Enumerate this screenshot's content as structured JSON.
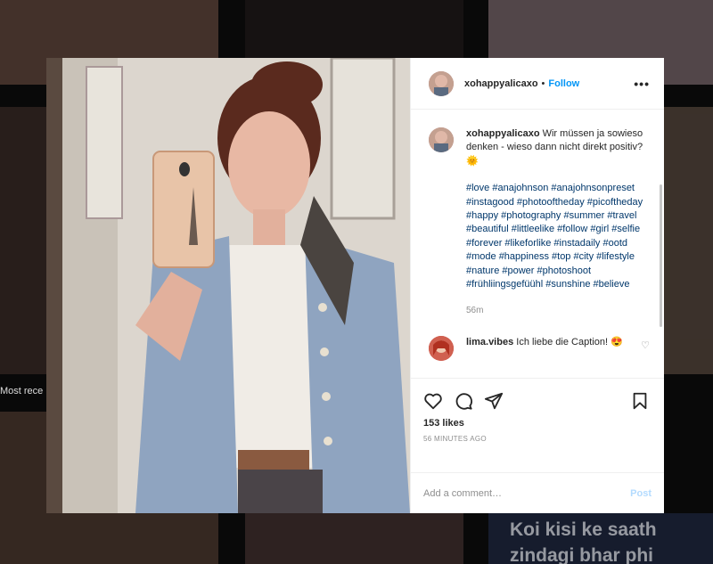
{
  "background": {
    "section_label": "Most rece",
    "text_line1": "Koi kisi ke saath",
    "text_line2": "zindagi bhar phi"
  },
  "post": {
    "username": "xohappyalicaxo",
    "separator": "•",
    "follow_label": "Follow",
    "more_label": "•••",
    "caption": {
      "username": "xohappyalicaxo",
      "text": "Wir müssen ja sowieso denken - wieso dann nicht direkt positiv? 🌞",
      "hashtags": "#love #anajohnson #anajohnsonpreset #instagood #photooftheday #picoftheday #happy #photography #summer #travel #beautiful #littleelike #follow #girl #selfie #forever #likeforlike #instadaily #ootd #mode #happiness #top #city #lifestyle #nature #power #photoshoot #frühliingsgefüühl #sunshine #believe",
      "time": "56m"
    },
    "comments": [
      {
        "username": "lima.vibes",
        "text": "Ich liebe die Caption! 😍"
      }
    ],
    "likes": "153 likes",
    "posted": "56 MINUTES AGO",
    "add_comment_placeholder": "Add a comment…",
    "post_label": "Post"
  },
  "colors": {
    "follow": "#0095f6",
    "hashtag": "#00376b",
    "post_disabled": "#b3dbff"
  }
}
